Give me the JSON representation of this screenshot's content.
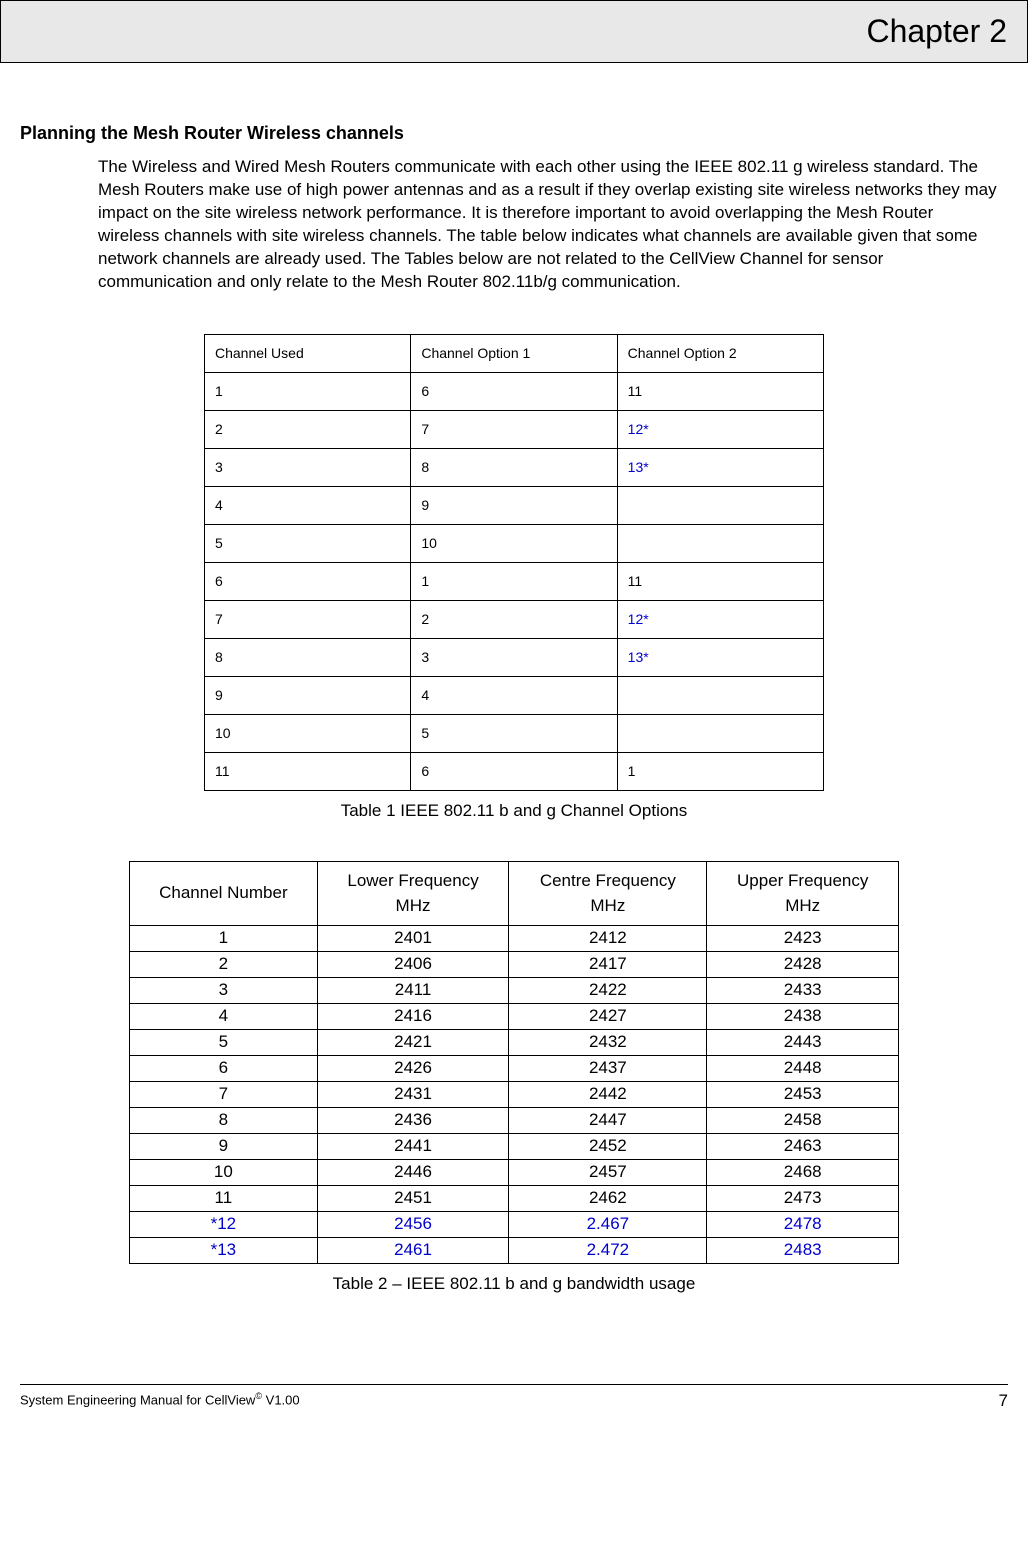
{
  "chapter": "Chapter 2",
  "sectionTitle": "Planning the Mesh Router Wireless channels",
  "bodyText": "The Wireless and Wired Mesh Routers communicate with each other using the IEEE 802.11 g wireless standard. The Mesh Routers make use of high power antennas and as a result if they overlap existing site wireless networks they may impact on the site wireless network performance. It is therefore important to avoid overlapping the Mesh Router wireless channels with site wireless channels. The table below indicates what channels are available given that some network channels are already used. The Tables below are not related to the CellView Channel for sensor communication and only relate to the Mesh Router 802.11b/g communication.",
  "table1": {
    "headers": [
      "Channel Used",
      "Channel Option 1",
      "Channel Option 2"
    ],
    "rows": [
      [
        "1",
        "6",
        "11",
        false
      ],
      [
        "2",
        "7",
        "12*",
        true
      ],
      [
        "3",
        "8",
        "13*",
        true
      ],
      [
        "4",
        "9",
        "",
        false
      ],
      [
        "5",
        "10",
        "",
        false
      ],
      [
        "6",
        "1",
        "11",
        false
      ],
      [
        "7",
        "2",
        "12*",
        true
      ],
      [
        "8",
        "3",
        "13*",
        true
      ],
      [
        "9",
        "4",
        "",
        false
      ],
      [
        "10",
        "5",
        "",
        false
      ],
      [
        "11",
        "6",
        "1",
        false
      ]
    ],
    "caption": "Table 1  IEEE 802.11 b and g Channel Options"
  },
  "table2": {
    "headers": [
      "Channel Number",
      "Lower Frequency MHz",
      "Centre Frequency MHz",
      "Upper Frequency MHz"
    ],
    "rows": [
      [
        "1",
        "2401",
        "2412",
        "2423",
        false
      ],
      [
        "2",
        "2406",
        "2417",
        "2428",
        false
      ],
      [
        "3",
        "2411",
        "2422",
        "2433",
        false
      ],
      [
        "4",
        "2416",
        "2427",
        "2438",
        false
      ],
      [
        "5",
        "2421",
        "2432",
        "2443",
        false
      ],
      [
        "6",
        "2426",
        "2437",
        "2448",
        false
      ],
      [
        "7",
        "2431",
        "2442",
        "2453",
        false
      ],
      [
        "8",
        "2436",
        "2447",
        "2458",
        false
      ],
      [
        "9",
        "2441",
        "2452",
        "2463",
        false
      ],
      [
        "10",
        "2446",
        "2457",
        "2468",
        false
      ],
      [
        "11",
        "2451",
        "2462",
        "2473",
        false
      ],
      [
        "*12",
        "2456",
        "2.467",
        "2478",
        true
      ],
      [
        "*13",
        "2461",
        "2.472",
        "2483",
        true
      ]
    ],
    "caption": "Table 2 – IEEE 802.11 b and g bandwidth usage"
  },
  "footer": {
    "left_prefix": "System Engineering Manual for CellView",
    "left_sup": "©",
    "left_suffix": " V1.00",
    "pageNumber": "7"
  }
}
